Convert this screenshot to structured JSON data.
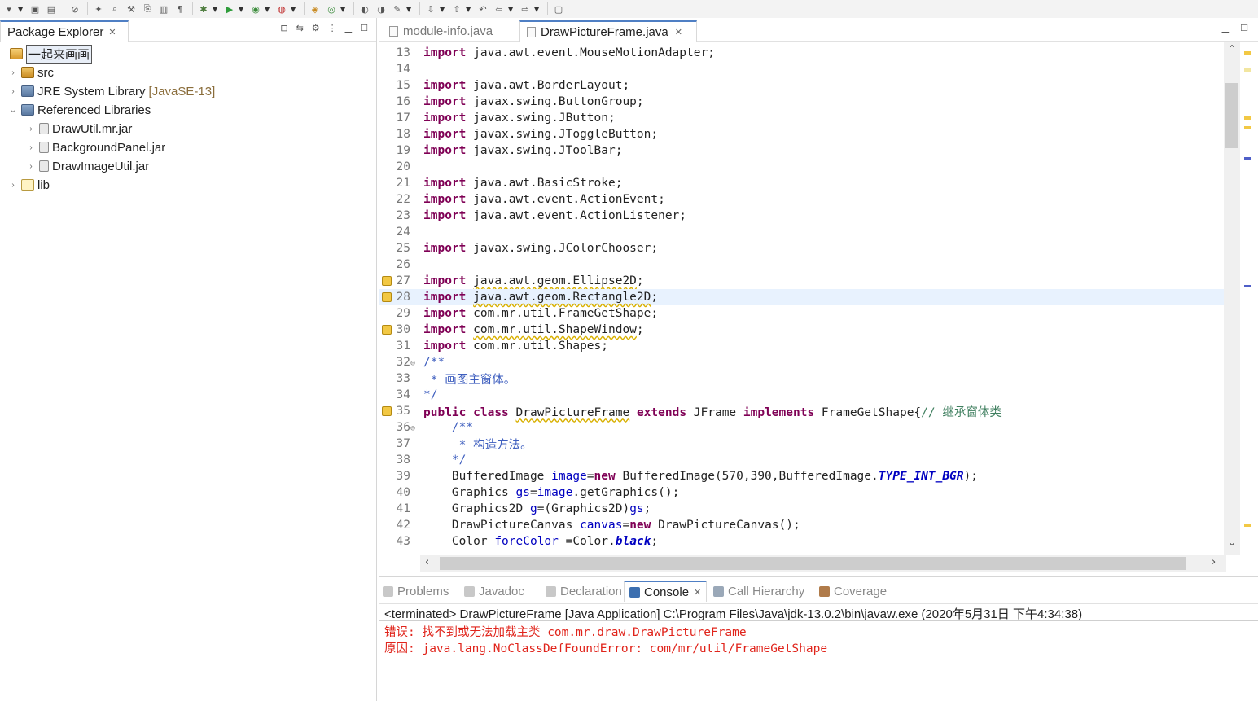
{
  "toolbar": {
    "icons": [
      "menu-icon",
      "save-icon",
      "save-all-icon",
      "skip-breakpoints-icon",
      "new-wizard-icon",
      "search-refs-icon",
      "external-tools-icon",
      "copy-icon",
      "paste-icon",
      "toggle-mark-icon",
      "debug-icon",
      "run-icon",
      "run-last-icon",
      "coverage-icon",
      "new-java-project-icon",
      "new-class-icon",
      "open-type-icon",
      "open-task-icon",
      "search-icon",
      "next-annotation-icon",
      "prev-annotation-icon",
      "last-edit-icon",
      "back-icon",
      "forward-icon",
      "open-perspective-icon"
    ]
  },
  "package_explorer": {
    "title": "Package Explorer",
    "close_glyph": "✕",
    "tree": [
      {
        "label": "一起来画画",
        "icon": "project-icon",
        "expandable": false,
        "selected": true
      },
      {
        "label": "src",
        "icon": "source-folder-icon",
        "expandable": true
      },
      {
        "label": "JRE System Library",
        "suffix": "[JavaSE-13]",
        "icon": "library-icon",
        "expandable": true
      },
      {
        "label": "Referenced Libraries",
        "icon": "library-icon",
        "expandable": true,
        "expanded": true
      },
      {
        "label": "DrawUtil.mr.jar",
        "icon": "jar-icon",
        "expandable": true
      },
      {
        "label": "BackgroundPanel.jar",
        "icon": "jar-icon",
        "expandable": true
      },
      {
        "label": "DrawImageUtil.jar",
        "icon": "jar-icon",
        "expandable": true
      },
      {
        "label": "lib",
        "icon": "folder-icon",
        "expandable": true
      }
    ]
  },
  "editor": {
    "tabs": [
      {
        "label": "module-info.java",
        "active": false
      },
      {
        "label": "DrawPictureFrame.java",
        "active": true
      }
    ],
    "current_line": 28,
    "lines": [
      {
        "n": "13",
        "html": "<span class='kw'>import</span> java.awt.event.MouseMotionAdapter;"
      },
      {
        "n": "14",
        "html": ""
      },
      {
        "n": "15",
        "html": "<span class='kw'>import</span> java.awt.BorderLayout;"
      },
      {
        "n": "16",
        "html": "<span class='kw'>import</span> javax.swing.ButtonGroup;"
      },
      {
        "n": "17",
        "html": "<span class='kw'>import</span> javax.swing.JButton;"
      },
      {
        "n": "18",
        "html": "<span class='kw'>import</span> javax.swing.JToggleButton;"
      },
      {
        "n": "19",
        "html": "<span class='kw'>import</span> javax.swing.JToolBar;"
      },
      {
        "n": "20",
        "html": ""
      },
      {
        "n": "21",
        "html": "<span class='kw'>import</span> java.awt.BasicStroke;"
      },
      {
        "n": "22",
        "html": "<span class='kw'>import</span> java.awt.event.ActionEvent;"
      },
      {
        "n": "23",
        "html": "<span class='kw'>import</span> java.awt.event.ActionListener;"
      },
      {
        "n": "24",
        "html": ""
      },
      {
        "n": "25",
        "html": "<span class='kw'>import</span> javax.swing.JColorChooser;"
      },
      {
        "n": "26",
        "html": ""
      },
      {
        "n": "27",
        "html": "<span class='kw'>import</span> <span class='warn'>java.awt.geom.Ellipse2D</span>;",
        "marker": true
      },
      {
        "n": "28",
        "html": "<span class='kw'>import</span> <span class='warn'>java.awt.geom.Rectangle2D</span>;",
        "marker": true
      },
      {
        "n": "29",
        "html": "<span class='kw'>import</span> com.mr.util.FrameGetShape;"
      },
      {
        "n": "30",
        "html": "<span class='kw'>import</span> <span class='warn'>com.mr.util.ShapeWindow</span>;",
        "marker": true
      },
      {
        "n": "31",
        "html": "<span class='kw'>import</span> com.mr.util.Shapes;"
      },
      {
        "n": "32",
        "html": "<span class='jd'>/**</span>",
        "fold": true
      },
      {
        "n": "33",
        "html": "<span class='jd'> * 画图主窗体。</span>"
      },
      {
        "n": "34",
        "html": "<span class='jd'>*/</span>"
      },
      {
        "n": "35",
        "html": "<span class='kw'>public</span> <span class='kw'>class</span> <span class='warn'>DrawPictureFrame</span> <span class='kw'>extends</span> JFrame <span class='kw'>implements</span> FrameGetShape{<span class='cm'>// 继承窗体类</span>",
        "marker": true
      },
      {
        "n": "36",
        "html": "    <span class='jd'>/**</span>",
        "fold": true
      },
      {
        "n": "37",
        "html": "<span class='jd'>     * 构造方法。</span>"
      },
      {
        "n": "38",
        "html": "<span class='jd'>    */</span>"
      },
      {
        "n": "39",
        "html": "    BufferedImage <span class='fld'>image</span>=<span class='kw'>new</span> BufferedImage(570,390,BufferedImage.<span class='sfld'>TYPE_INT_BGR</span>);"
      },
      {
        "n": "40",
        "html": "    Graphics <span class='fld'>gs</span>=<span class='fld'>image</span>.getGraphics();"
      },
      {
        "n": "41",
        "html": "    Graphics2D <span class='fld'>g</span>=(Graphics2D)<span class='fld'>gs</span>;"
      },
      {
        "n": "42",
        "html": "    DrawPictureCanvas <span class='fld'>canvas</span>=<span class='kw'>new</span> DrawPictureCanvas();"
      },
      {
        "n": "43",
        "html": "    Color <span class='fld'>foreColor</span> =Color.<span class='sfld'>black</span>;"
      }
    ]
  },
  "bottom_panel": {
    "tabs": [
      {
        "label": "Problems",
        "icon": "problems-icon",
        "active": false
      },
      {
        "label": "Javadoc",
        "icon": "javadoc-icon",
        "active": false
      },
      {
        "label": "Declaration",
        "icon": "declaration-icon",
        "active": false
      },
      {
        "label": "Console",
        "icon": "console-icon",
        "active": true
      },
      {
        "label": "Call Hierarchy",
        "icon": "call-hierarchy-icon",
        "active": false
      },
      {
        "label": "Coverage",
        "icon": "coverage-icon",
        "active": false
      }
    ],
    "console_header": "<terminated> DrawPictureFrame [Java Application] C:\\Program Files\\Java\\jdk-13.0.2\\bin\\javaw.exe (2020年5月31日 下午4:34:38)",
    "error_lines": [
      "错误: 找不到或无法加载主类 com.mr.draw.DrawPictureFrame",
      "原因: java.lang.NoClassDefFoundError: com/mr/util/FrameGetShape"
    ]
  },
  "colors": {
    "keyword": "#7f0055",
    "comment": "#3f7f5f",
    "javadoc": "#3f5fbf",
    "field": "#0000c0",
    "error": "#e0241b",
    "active_tab_border": "#4f7fc4",
    "current_line_bg": "#e8f2fe"
  }
}
